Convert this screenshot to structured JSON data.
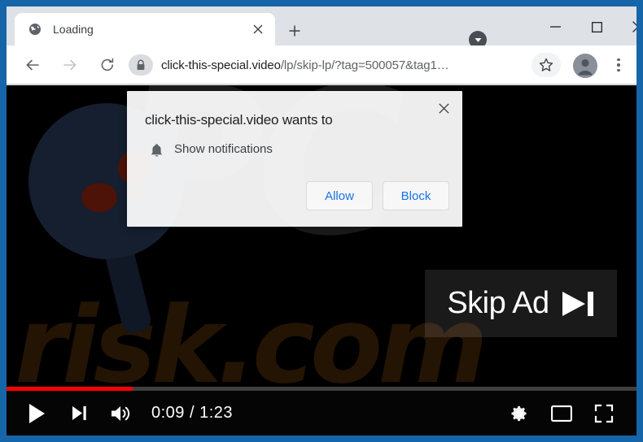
{
  "browser": {
    "tab": {
      "title": "Loading",
      "favicon": "globe-icon",
      "close_label": "×"
    },
    "new_tab_label": "+",
    "window_controls": {
      "chevron": "▼",
      "minimize": "—",
      "maximize": "□",
      "close": "✕"
    },
    "nav": {
      "back": "back-arrow",
      "forward": "forward-arrow",
      "reload": "reload-icon"
    },
    "omnibox": {
      "lock": "lock-icon",
      "url_domain": "click-this-special.video",
      "url_path": "/lp/skip-lp/?tag=500057&tag1…",
      "url_full": "click-this-special.video/lp/skip-lp/?tag=500057&tag1…"
    },
    "toolbar": {
      "bookmark": "star-icon",
      "profile": "avatar-icon",
      "menu": "three-dot-menu-icon"
    }
  },
  "notification_dialog": {
    "title": "click-this-special.video wants to",
    "permission_icon": "bell-icon",
    "permission_label": "Show notifications",
    "allow_label": "Allow",
    "block_label": "Block",
    "close_label": "✕",
    "accent_color": "#1a73e8"
  },
  "video": {
    "watermark_top": "PC",
    "watermark_bottom": "risk.com",
    "skip_ad": {
      "label": "Skip Ad",
      "icon": "skip-next-icon"
    },
    "player": {
      "play_icon": "play-icon",
      "next_icon": "next-track-icon",
      "volume_icon": "volume-icon",
      "current_time": "0:09",
      "total_time": "1:23",
      "time_display": "0:09 / 1:23",
      "progress_percent": 20,
      "progress_color": "#ff0000",
      "settings_icon": "gear-icon",
      "miniplayer_icon": "miniplayer-icon",
      "fullscreen_icon": "fullscreen-icon"
    }
  }
}
